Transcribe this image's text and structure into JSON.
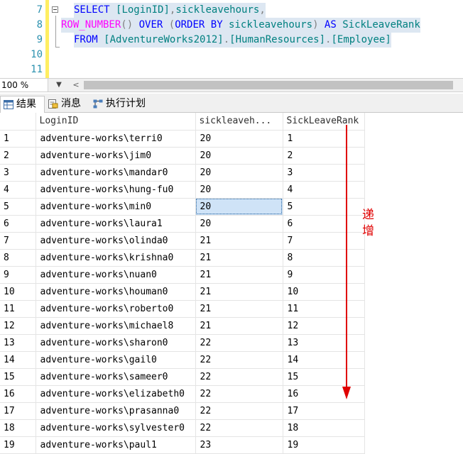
{
  "editor": {
    "lines": [
      {
        "num": "7",
        "segments": [
          {
            "text": "SELECT ",
            "cls": "kw"
          },
          {
            "text": "[LoginID]",
            "cls": "id"
          },
          {
            "text": ",",
            "cls": "gr"
          },
          {
            "text": "sickleavehours",
            "cls": "id"
          },
          {
            "text": ",",
            "cls": "gr"
          }
        ]
      },
      {
        "num": "8",
        "segments": [
          {
            "text": "ROW_NUMBER",
            "cls": "fn"
          },
          {
            "text": "() ",
            "cls": "gr"
          },
          {
            "text": "OVER ",
            "cls": "kw"
          },
          {
            "text": "(",
            "cls": "gr"
          },
          {
            "text": "ORDER BY ",
            "cls": "kw"
          },
          {
            "text": "sickleavehours",
            "cls": "id"
          },
          {
            "text": ") ",
            "cls": "gr"
          },
          {
            "text": "AS ",
            "cls": "kw"
          },
          {
            "text": "SickLeaveRank",
            "cls": "id"
          }
        ]
      },
      {
        "num": "9",
        "segments": [
          {
            "text": "FROM ",
            "cls": "kw"
          },
          {
            "text": "[AdventureWorks2012]",
            "cls": "id"
          },
          {
            "text": ".",
            "cls": "gr"
          },
          {
            "text": "[HumanResources]",
            "cls": "id"
          },
          {
            "text": ".",
            "cls": "gr"
          },
          {
            "text": "[Employee]",
            "cls": "id"
          }
        ]
      },
      {
        "num": "10",
        "segments": []
      },
      {
        "num": "11",
        "segments": []
      }
    ]
  },
  "zoom": {
    "value": "100 %",
    "dropdown_icon": "chevron-down-icon",
    "scroll_left_icon": "chevron-left-icon"
  },
  "tabs": [
    {
      "label": "结果",
      "icon": "grid-icon",
      "active": true
    },
    {
      "label": "消息",
      "icon": "messages-icon",
      "active": false
    },
    {
      "label": "执行计划",
      "icon": "execution-plan-icon",
      "active": false
    }
  ],
  "grid": {
    "columns": [
      "LoginID",
      "sickleaveh...",
      "SickLeaveRank"
    ],
    "rows": [
      {
        "n": "1",
        "login": "adventure-works\\terri0",
        "hours": "20",
        "rank": "1"
      },
      {
        "n": "2",
        "login": "adventure-works\\jim0",
        "hours": "20",
        "rank": "2"
      },
      {
        "n": "3",
        "login": "adventure-works\\mandar0",
        "hours": "20",
        "rank": "3"
      },
      {
        "n": "4",
        "login": "adventure-works\\hung-fu0",
        "hours": "20",
        "rank": "4"
      },
      {
        "n": "5",
        "login": "adventure-works\\min0",
        "hours": "20",
        "rank": "5"
      },
      {
        "n": "6",
        "login": "adventure-works\\laura1",
        "hours": "20",
        "rank": "6"
      },
      {
        "n": "7",
        "login": "adventure-works\\olinda0",
        "hours": "21",
        "rank": "7"
      },
      {
        "n": "8",
        "login": "adventure-works\\krishna0",
        "hours": "21",
        "rank": "8"
      },
      {
        "n": "9",
        "login": "adventure-works\\nuan0",
        "hours": "21",
        "rank": "9"
      },
      {
        "n": "10",
        "login": "adventure-works\\houman0",
        "hours": "21",
        "rank": "10"
      },
      {
        "n": "11",
        "login": "adventure-works\\roberto0",
        "hours": "21",
        "rank": "11"
      },
      {
        "n": "12",
        "login": "adventure-works\\michael8",
        "hours": "21",
        "rank": "12"
      },
      {
        "n": "13",
        "login": "adventure-works\\sharon0",
        "hours": "22",
        "rank": "13"
      },
      {
        "n": "14",
        "login": "adventure-works\\gail0",
        "hours": "22",
        "rank": "14"
      },
      {
        "n": "15",
        "login": "adventure-works\\sameer0",
        "hours": "22",
        "rank": "15"
      },
      {
        "n": "16",
        "login": "adventure-works\\elizabeth0",
        "hours": "22",
        "rank": "16"
      },
      {
        "n": "17",
        "login": "adventure-works\\prasanna0",
        "hours": "22",
        "rank": "17"
      },
      {
        "n": "18",
        "login": "adventure-works\\sylvester0",
        "hours": "22",
        "rank": "18"
      },
      {
        "n": "19",
        "login": "adventure-works\\paul1",
        "hours": "23",
        "rank": "19"
      }
    ],
    "selected_row": 5
  },
  "annotation": {
    "text": "递增",
    "color": "#e00000"
  },
  "colors": {
    "keyword": "#0000ff",
    "function": "#ff00ff",
    "identifier": "#008080",
    "punctuation": "#808080",
    "line_number": "#2b91af",
    "selection": "#cfe3f7"
  }
}
